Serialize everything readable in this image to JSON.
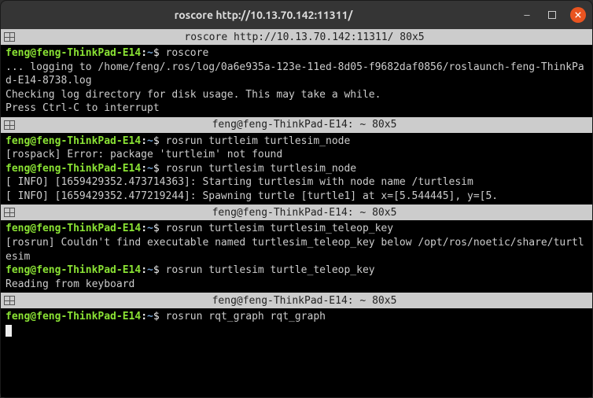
{
  "window": {
    "title": "roscore http://10.13.70.142:11311/"
  },
  "prompt": {
    "user": "feng",
    "host": "feng-ThinkPad-E14",
    "path": "~",
    "sep_userhost": "@",
    "sep_hostpath": ":",
    "symbol": "$"
  },
  "panes": [
    {
      "title": "roscore http://10.13.70.142:11311/ 80x5",
      "lines": [
        {
          "type": "cmd",
          "text": "roscore"
        },
        {
          "type": "out",
          "text": "... logging to /home/feng/.ros/log/0a6e935a-123e-11ed-8d05-f9682daf0856/roslaunch-feng-ThinkPad-E14-8738.log"
        },
        {
          "type": "out",
          "text": "Checking log directory for disk usage. This may take a while."
        },
        {
          "type": "out",
          "text": "Press Ctrl-C to interrupt"
        }
      ]
    },
    {
      "title": "feng@feng-ThinkPad-E14: ~ 80x5",
      "lines": [
        {
          "type": "cmd",
          "text": "rosrun turtleim turtlesim_node"
        },
        {
          "type": "out",
          "text": "[rospack] Error: package 'turtleim' not found"
        },
        {
          "type": "cmd",
          "text": "rosrun turtlesim turtlesim_node"
        },
        {
          "type": "out",
          "text": "[ INFO] [1659429352.473714363]: Starting turtlesim with node name /turtlesim"
        },
        {
          "type": "out",
          "text": "[ INFO] [1659429352.477219244]: Spawning turtle [turtle1] at x=[5.544445], y=[5."
        }
      ]
    },
    {
      "title": "feng@feng-ThinkPad-E14: ~ 80x5",
      "lines": [
        {
          "type": "cmd",
          "text": "rosrun turtlesim turtlesim_teleop_key"
        },
        {
          "type": "out",
          "text": "[rosrun] Couldn't find executable named turtlesim_teleop_key below /opt/ros/noetic/share/turtlesim"
        },
        {
          "type": "cmd",
          "text": "rosrun turtlesim turtle_teleop_key"
        },
        {
          "type": "out",
          "text": "Reading from keyboard"
        }
      ]
    },
    {
      "title": "feng@feng-ThinkPad-E14: ~ 80x5",
      "lines": [
        {
          "type": "cmd",
          "text": "rosrun rqt_graph rqt_graph"
        },
        {
          "type": "cursor"
        }
      ]
    }
  ]
}
